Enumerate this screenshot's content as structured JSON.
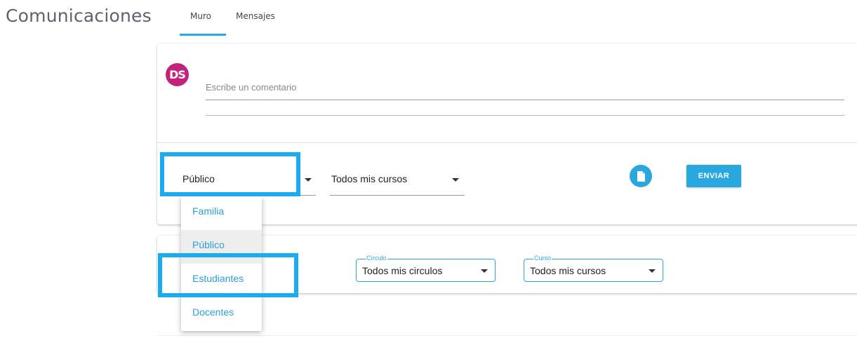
{
  "header": {
    "title": "Comunicaciones",
    "tabs": [
      {
        "label": "Muro",
        "active": true
      },
      {
        "label": "Mensajes",
        "active": false
      }
    ]
  },
  "compose": {
    "avatar_initials": "DS",
    "avatar_color": "#c2227a",
    "comment_placeholder": "Escribe un comentario",
    "visibility_value": "Público",
    "courses_value": "Todos mis cursos",
    "attach_icon": "file-icon",
    "send_label": "ENVIAR"
  },
  "visibility_dropdown": {
    "options": [
      "Familia",
      "Público",
      "Estudiantes",
      "Docentes"
    ],
    "hovered": "Público"
  },
  "filters": {
    "circulo": {
      "label": "Círculo",
      "value": "Todos mis circulos"
    },
    "curso": {
      "label": "Curso",
      "value": "Todos mis cursos"
    }
  },
  "colors": {
    "accent": "#29a8e0",
    "highlight": "#1aacef",
    "avatar": "#c2227a"
  }
}
